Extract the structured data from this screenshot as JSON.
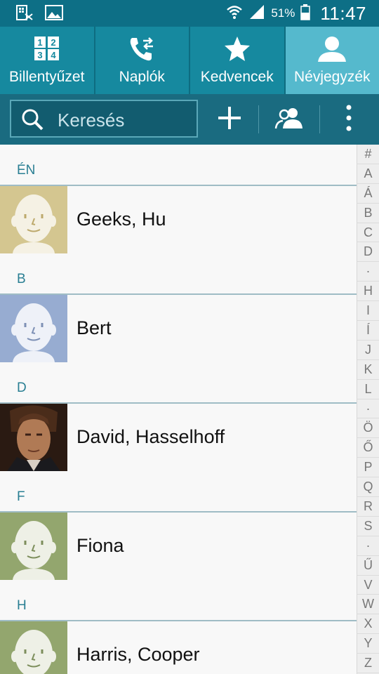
{
  "status_bar": {
    "battery_percent": "51%",
    "time": "11:47",
    "icons": [
      "card-reader-icon",
      "image-icon",
      "wifi-icon",
      "signal-icon",
      "battery-icon"
    ]
  },
  "tabs": [
    {
      "label": "Billentyűzet",
      "icon": "dialpad-icon",
      "active": false
    },
    {
      "label": "Naplók",
      "icon": "call-log-icon",
      "active": false
    },
    {
      "label": "Kedvencek",
      "icon": "star-icon",
      "active": false
    },
    {
      "label": "Névjegyzék",
      "icon": "person-icon",
      "active": true
    }
  ],
  "actionbar": {
    "search_placeholder": "Keresés",
    "buttons": [
      "add-icon",
      "groups-icon",
      "more-vertical-icon"
    ]
  },
  "sections": [
    {
      "header": "ÉN",
      "contact": {
        "name": "Geeks, Hu",
        "avatar_color": "#d4c690",
        "photo": false
      }
    },
    {
      "header": "B",
      "contact": {
        "name": "Bert",
        "avatar_color": "#97acd1",
        "photo": false
      }
    },
    {
      "header": "D",
      "contact": {
        "name": "David, Hasselhoff",
        "avatar_color": "#3a2418",
        "photo": true
      }
    },
    {
      "header": "F",
      "contact": {
        "name": "Fiona",
        "avatar_color": "#93a66e",
        "photo": false
      }
    },
    {
      "header": "H",
      "contact": {
        "name": "Harris, Cooper",
        "avatar_color": "#93a66e",
        "photo": false
      }
    }
  ],
  "index_letters": [
    "#",
    "A",
    "Á",
    "B",
    "C",
    "D",
    "·",
    "H",
    "I",
    "Í",
    "J",
    "K",
    "L",
    "·",
    "Ö",
    "Ő",
    "P",
    "Q",
    "R",
    "S",
    "·",
    "Ű",
    "V",
    "W",
    "X",
    "Y",
    "Z"
  ],
  "colors": {
    "status_bar": "#0d6f86",
    "tab_bar": "#16899f",
    "tab_active": "#55b9cd",
    "action_bar": "#1a6b80",
    "section_header_text": "#2a7f93"
  }
}
